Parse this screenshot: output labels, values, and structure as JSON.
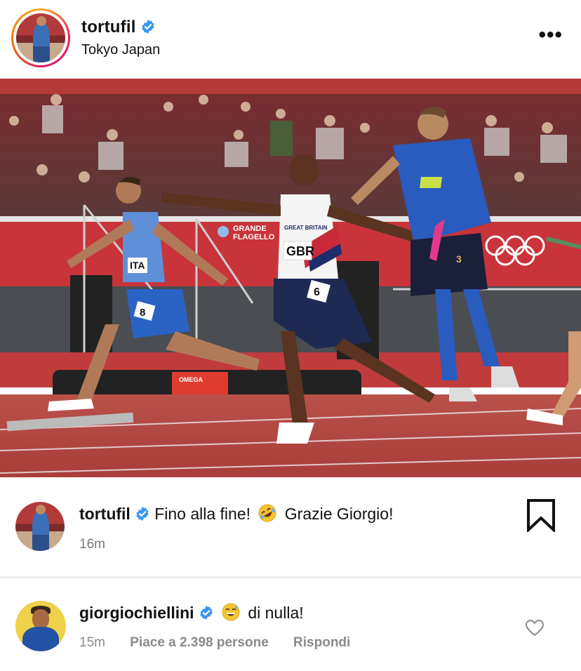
{
  "post": {
    "username": "tortufil",
    "location": "Tokyo Japan",
    "more_icon": "more-horizontal-icon"
  },
  "photo": {
    "sign_text_line1": "GRANDE",
    "sign_text_line2": "FLAGELLO",
    "bib_italy": "ITA",
    "bib_gbr": "GBR",
    "jersey_gbr": "GREAT BRITAIN",
    "number_italy": "8",
    "number_gbr": "6",
    "number_chiellini": "3",
    "block_brand": "OMEGA"
  },
  "caption": {
    "username": "tortufil",
    "text_before_emoji": "Fino alla fine!",
    "emoji": "rolling-on-floor-laughing-emoji",
    "text_after_emoji": "Grazie Giorgio!",
    "time": "16m"
  },
  "comment": {
    "username": "giorgiochiellini",
    "emoji": "grinning-sweat-emoji",
    "text": "di nulla!",
    "time": "15m",
    "likes": "Piace a 2.398 persone",
    "reply": "Rispondi"
  },
  "colors": {
    "verified": "#3897f0",
    "muted": "#8a8a8a",
    "track": "#b5423e",
    "italy_blue": "#2b63c4"
  }
}
